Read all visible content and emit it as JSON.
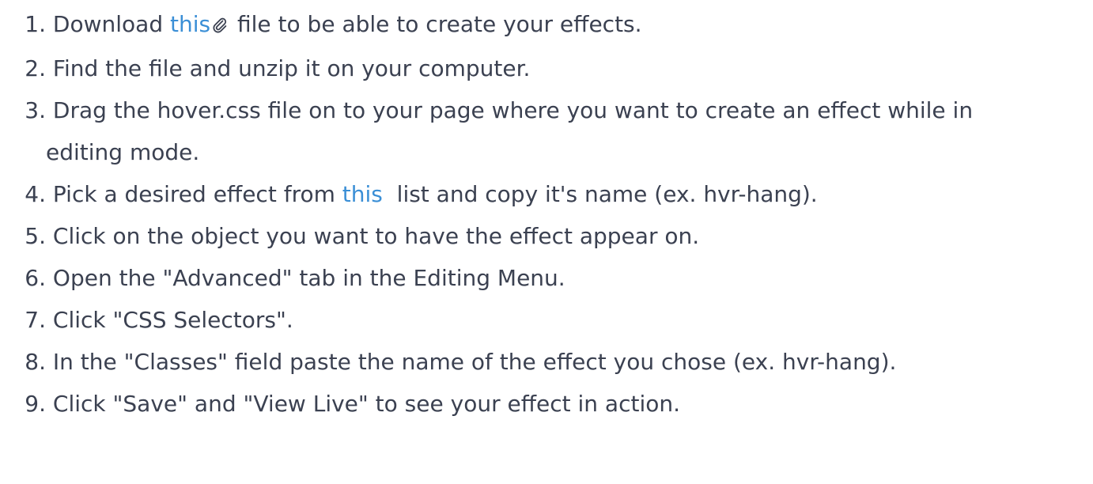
{
  "steps": [
    {
      "number": "1.",
      "before": "Download ",
      "link": "this",
      "icon": "paperclip-icon",
      "after": " file to be able to create your effects."
    },
    {
      "number": "2.",
      "text": "Find the file and unzip it on your computer."
    },
    {
      "number": "3.",
      "text": "Drag the hover.css file on to your page where you want to create an effect while in editing mode."
    },
    {
      "number": "4.",
      "before": "Pick a desired effect from ",
      "link": "this",
      "after": "  list and copy it's name (ex. hvr-hang)."
    },
    {
      "number": "5.",
      "text": "Click on the object you want to have the effect appear on."
    },
    {
      "number": "6.",
      "text": "Open the \"Advanced\" tab in the Editing Menu."
    },
    {
      "number": "7.",
      "text": "Click \"CSS Selectors\"."
    },
    {
      "number": "8.",
      "text": "In the \"Classes\" field paste the name of the effect you chose (ex. hvr-hang)."
    },
    {
      "number": "9.",
      "text": "Click \"Save\" and \"View Live\" to see your effect in action."
    }
  ],
  "colors": {
    "text": "#3b4151",
    "link": "#3b8fd6"
  }
}
